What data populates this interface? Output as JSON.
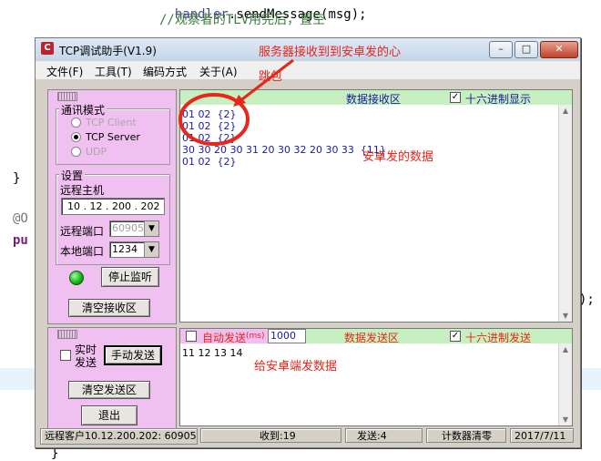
{
  "code": {
    "line1_obj": "handler",
    "line1_call": ".sendMessage(msg);",
    "line2_comment": "//观察者的TLV用完后，置空",
    "brace1": "}",
    "annot": "@O",
    "pu": "pu",
    "tail": ");",
    "brace2": "}"
  },
  "window": {
    "title": "TCP调试助手(V1.9)",
    "min_label": "–",
    "max_label": "□",
    "close_label": "✕"
  },
  "menu": [
    "文件(F)",
    "工具(T)",
    "编码方式",
    "关于(A)"
  ],
  "mode": {
    "label": "通讯模式",
    "options": [
      {
        "label": "TCP Client",
        "selected": false,
        "enabled": false
      },
      {
        "label": "TCP Server",
        "selected": true,
        "enabled": true
      },
      {
        "label": "UDP",
        "selected": false,
        "enabled": false
      }
    ]
  },
  "settings": {
    "label": "设置",
    "remote_host_label": "远程主机",
    "remote_host_value": "10 . 12 . 200 . 202",
    "remote_port_label": "远程端口",
    "remote_port_value": "60905",
    "local_port_label": "本地端口",
    "local_port_value": "1234"
  },
  "buttons": {
    "stop_listen": "停止监听",
    "clear_receive": "清空接收区",
    "manual_send": "手动发送",
    "clear_send": "清空发送区",
    "exit": "退出"
  },
  "realtime": {
    "line1": "实时",
    "line2": "发送"
  },
  "receive": {
    "title": "数据接收区",
    "hex_label": "十六进制显示",
    "hex_checked": true,
    "lines": [
      "01 02  {2}",
      "01 02  {2}",
      "01 02  {2}",
      "30 30 20 30 31 20 30 32 20 30 33  {11}",
      "01 02  {2}"
    ]
  },
  "send": {
    "auto_label": "自动发送",
    "auto_unit": "(ms)",
    "interval": "1000",
    "title": "数据发送区",
    "hex_label": "十六进制发送",
    "hex_checked": true,
    "content": "11 12 13 14"
  },
  "status": {
    "remote": "远程客户10.12.200.202: 60905",
    "received": "收到:19",
    "sent": "发送:4",
    "reset": "计数器清零",
    "date": "2017/7/11"
  },
  "annotations": {
    "heartbeat": "服务器接收到到安卓发的心跳包",
    "android_data": "安卓发的数据",
    "send_to_android": "给安卓端发数据"
  },
  "colors": {
    "panel": "#f0c0f0",
    "header": "#c6f0c0",
    "annotation": "#e8261a",
    "received_text": "#1a1aa0"
  }
}
